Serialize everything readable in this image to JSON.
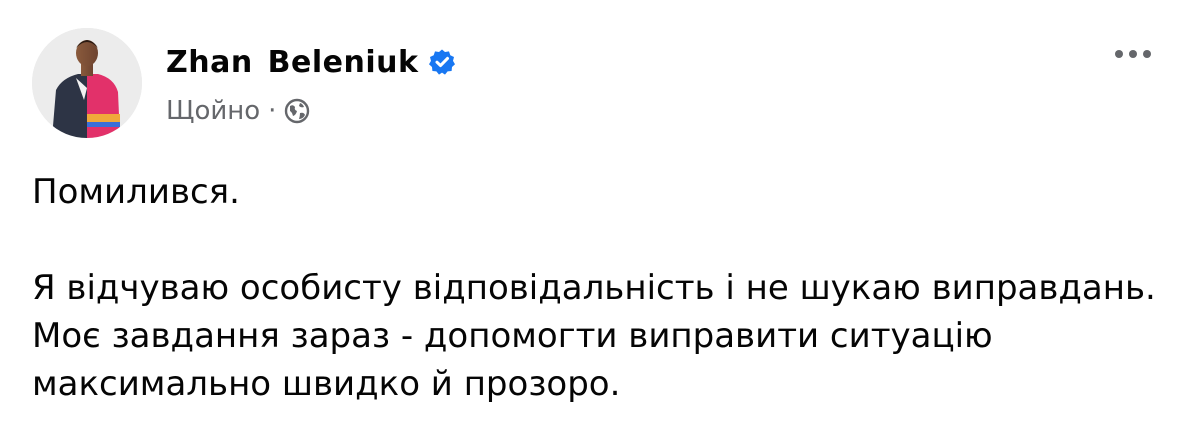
{
  "post": {
    "author": {
      "name": "Zhan  Beleniuk",
      "verified_icon": "verified-badge-icon"
    },
    "meta": {
      "time": "Щойно",
      "separator": "·",
      "audience_icon": "globe-icon"
    },
    "more_icon": "more-options-icon",
    "body": {
      "line1": "Помилився.",
      "paragraph2": "Я відчуваю особисту відповідальність і не шукаю виправдань. Моє завдання зараз - допомогти виправити ситуацію максимально швидко й прозоро."
    }
  },
  "colors": {
    "text": "#050505",
    "secondary": "#65676b",
    "verified": "#1877f2"
  }
}
